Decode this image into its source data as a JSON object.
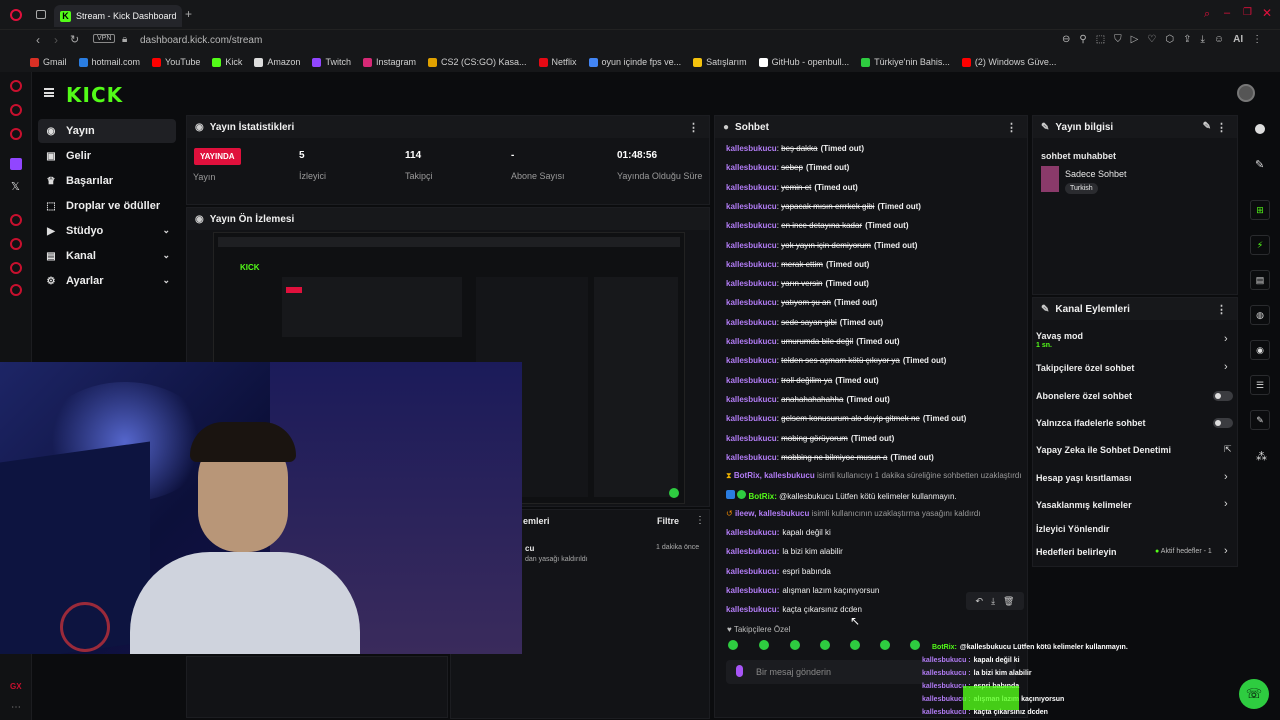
{
  "browser": {
    "tab_title": "Stream - Kick Dashboard",
    "url": "dashboard.kick.com/stream",
    "vpn": "VPN",
    "ai": "AI"
  },
  "bookmarks": [
    {
      "label": "Gmail",
      "color": "#d93025"
    },
    {
      "label": "hotmail.com",
      "color": "#2a7de1"
    },
    {
      "label": "YouTube",
      "color": "#ff0000"
    },
    {
      "label": "Kick",
      "color": "#53fc18"
    },
    {
      "label": "Amazon",
      "color": "#dddddd"
    },
    {
      "label": "Twitch",
      "color": "#9146ff"
    },
    {
      "label": "Instagram",
      "color": "#d62976"
    },
    {
      "label": "CS2 (CS:GO) Kasa...",
      "color": "#e0a100"
    },
    {
      "label": "Netflix",
      "color": "#e50914"
    },
    {
      "label": "oyun içinde fps ve...",
      "color": "#4285f4"
    },
    {
      "label": "Satışlarım",
      "color": "#f4c20d"
    },
    {
      "label": "GitHub - openbull...",
      "color": "#ffffff"
    },
    {
      "label": "Türkiye'nin Bahis...",
      "color": "#2ecc40"
    },
    {
      "label": "(2) Windows Güve...",
      "color": "#ff0000"
    }
  ],
  "sidebar": {
    "items": [
      {
        "label": "Yayın",
        "icon": "broadcast-icon"
      },
      {
        "label": "Gelir",
        "icon": "money-icon"
      },
      {
        "label": "Başarılar",
        "icon": "trophy-icon"
      },
      {
        "label": "Droplar ve ödüller",
        "icon": "gift-icon"
      },
      {
        "label": "Stüdyo",
        "icon": "studio-icon"
      },
      {
        "label": "Kanal",
        "icon": "channel-icon"
      },
      {
        "label": "Ayarlar",
        "icon": "gear-icon"
      }
    ]
  },
  "stats": {
    "title": "Yayın İstatistikleri",
    "live_badge": "YAYINDA",
    "live_label": "Yayın",
    "viewers": "5",
    "viewers_label": "İzleyici",
    "followers": "114",
    "followers_label": "Takipçi",
    "subs": "-",
    "subs_label": "Abone Sayısı",
    "duration": "01:48:56",
    "duration_label": "Yayında Olduğu Süre"
  },
  "preview": {
    "title": "Yayın Ön İzlemesi"
  },
  "logs": {
    "title_partial": "emleri",
    "filter": "Filtre",
    "item_user_partial": "cu",
    "item_text_partial": "dan yasağı kaldırıldı",
    "item_time": "1 dakika önce"
  },
  "chat": {
    "title": "Sohbet",
    "lines": [
      {
        "user": "kallesbukucu",
        "msg": "beş dakka",
        "tag": "(Timed out)"
      },
      {
        "user": "kallesbukucu",
        "msg": "sebep",
        "tag": "(Timed out)"
      },
      {
        "user": "kallesbukucu",
        "msg": "yemin et",
        "tag": "(Timed out)"
      },
      {
        "user": "kallesbukucu",
        "msg": "yapacak mısın errrkek gibi",
        "tag": "(Timed out)"
      },
      {
        "user": "kallesbukucu",
        "msg": "en ince detayına kadar",
        "tag": "(Timed out)"
      },
      {
        "user": "kallesbukucu",
        "msg": "yok yayın için demiyorum",
        "tag": "(Timed out)"
      },
      {
        "user": "kallesbukucu",
        "msg": "merak ettim",
        "tag": "(Timed out)"
      },
      {
        "user": "kallesbukucu",
        "msg": "yarın versin",
        "tag": "(Timed out)"
      },
      {
        "user": "kallesbukucu",
        "msg": "yatıyom şu an",
        "tag": "(Timed out)"
      },
      {
        "user": "kallesbukucu",
        "msg": "sede sayan gibi",
        "tag": "(Timed out)"
      },
      {
        "user": "kallesbukucu",
        "msg": "umurumda bile değil",
        "tag": "(Timed out)"
      },
      {
        "user": "kallesbukucu",
        "msg": "telden ses açmam kötü çıkıyor ya",
        "tag": "(Timed out)"
      },
      {
        "user": "kallesbukucu",
        "msg": "troll değilim ya",
        "tag": "(Timed out)"
      },
      {
        "user": "kallesbukucu",
        "msg": "anahahahahahha",
        "tag": "(Timed out)"
      },
      {
        "user": "kallesbukucu",
        "msg": "gelsem konusurum alo deyip gitmek ne",
        "tag": "(Timed out)"
      },
      {
        "user": "kallesbukucu",
        "msg": "mobing görüyorum",
        "tag": "(Timed out)"
      },
      {
        "user": "kallesbukucu",
        "msg": "mobbing ne bilmiyoe musun a",
        "tag": "(Timed out)"
      }
    ],
    "sys1": {
      "users": "BotRix, kallesbukucu",
      "text": "isimli kullanıcıyı 1 dakika süreliğine sohbetten uzaklaştırdı"
    },
    "bot": {
      "user": "BotRix:",
      "text": "@kallesbukucu Lütfen kötü kelimeler kullanmayın."
    },
    "sys2": {
      "users": "ileew, kallesbukucu",
      "text": "isimli kullanıcının uzaklaştırma yasağını kaldırdı"
    },
    "recent": [
      {
        "user": "kallesbukucu:",
        "msg": "kapalı değil ki"
      },
      {
        "user": "kallesbukucu:",
        "msg": "la bizi kim alabilir"
      },
      {
        "user": "kallesbukucu:",
        "msg": "espri babında"
      },
      {
        "user": "kallesbukucu:",
        "msg": "alışman lazım kaçınıyorsun"
      },
      {
        "user": "kallesbukucu:",
        "msg": "kaçta çıkarsınız dcden"
      }
    ],
    "followers_only": "Takipçilere Özel",
    "placeholder": "Bir mesaj gönderin"
  },
  "info": {
    "title": "Yayın bilgisi",
    "stream_title": "sohbet muhabbet",
    "category": "Sadece Sohbet",
    "tag": "Turkish"
  },
  "actions": {
    "title": "Kanal Eylemleri",
    "slow_mode": "Yavaş mod",
    "slow_value": "1 sn.",
    "followers_chat": "Takipçilere özel sohbet",
    "subs_chat": "Abonelere özel sohbet",
    "emote_chat": "Yalnızca ifadelerle sohbet",
    "ai_mod": "Yapay Zeka ile Sohbet Denetimi",
    "age": "Hesap yaşı kısıtlaması",
    "banned": "Yasaklanmış kelimeler",
    "viewer_dir": "İzleyici Yönlendir",
    "goals": "Hedefleri belirleyin",
    "goals_status": "Aktif hedefler - 1"
  },
  "overlay": [
    {
      "user": "BotRix:",
      "msg": "@kallesbukucu Lütfen kötü kelimeler kullanmayın."
    },
    {
      "user": "kallesbukucu :",
      "msg": "kapalı değil ki"
    },
    {
      "user": "kallesbukucu :",
      "msg": "la bizi kim alabilir"
    },
    {
      "user": "kallesbukucu :",
      "msg": "espri babında"
    },
    {
      "user": "kallesbukucu :",
      "msg": "alışman lazım kaçınıyorsun"
    },
    {
      "user": "kallesbukucu :",
      "msg": "kaçta çıkarsınız dcden"
    }
  ],
  "misc": {
    "gx": "GX"
  }
}
